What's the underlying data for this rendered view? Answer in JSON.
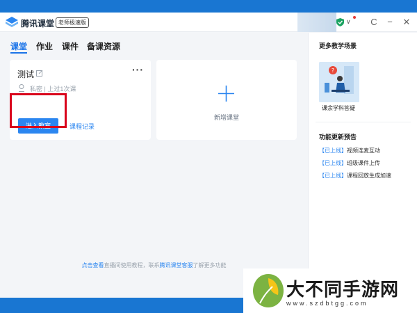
{
  "app": {
    "title": "腾讯课堂",
    "edition": "老师极速版",
    "window_buttons": {
      "refresh": "C",
      "minimize": "−",
      "close": "✕"
    },
    "dropdown_glyph": "∨"
  },
  "tabs": [
    {
      "label": "课堂",
      "active": true
    },
    {
      "label": "作业",
      "active": false
    },
    {
      "label": "课件",
      "active": false
    },
    {
      "label": "备课资源",
      "active": false
    }
  ],
  "class_card": {
    "name": "测试",
    "more": "···",
    "privacy": "私密",
    "separator": "|",
    "last_class": "上过1次课",
    "enter_button": "进入教室",
    "record_link": "课程记录"
  },
  "new_card": {
    "label": "新增课堂"
  },
  "footer": {
    "link1": "点击查看",
    "text1": "直播间使用教程，联系",
    "link2": "腾讯课堂客服",
    "text2": "了解更多功能"
  },
  "side": {
    "scenes_title": "更多教学场景",
    "scene_label": "课余学科答疑",
    "updates_title": "功能更新预告",
    "updates": [
      {
        "tag": "【已上线】",
        "text": "视频连麦互动"
      },
      {
        "tag": "【已上线】",
        "text": "班级课件上传"
      },
      {
        "tag": "【已上线】",
        "text": "课程回放生成加速"
      }
    ]
  },
  "watermark": {
    "text": "大不同手游网",
    "url": "www.szdbtgg.com"
  },
  "colors": {
    "accent": "#2b86f0",
    "highlight": "#d9001b",
    "background": "#f3f5f8"
  }
}
